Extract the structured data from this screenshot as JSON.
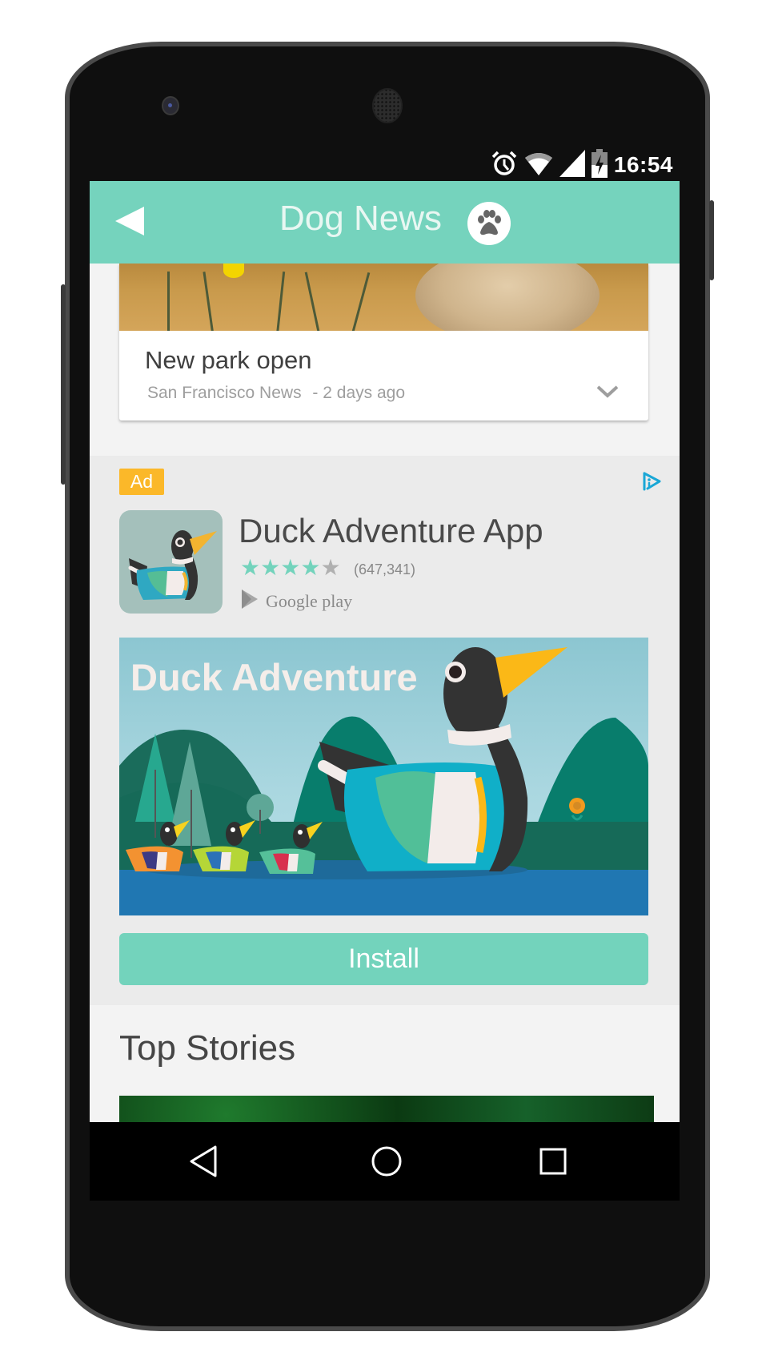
{
  "status_bar": {
    "time": "16:54",
    "icons": [
      "alarm-icon",
      "wifi-icon",
      "cellular-signal-icon",
      "battery-charging-icon"
    ]
  },
  "app_bar": {
    "back_icon": "back-arrow-icon",
    "title": "Dog News",
    "logo_icon": "paw-icon",
    "accent_color": "#75d3bd"
  },
  "news_card": {
    "title": "New park open",
    "source": "San Francisco News",
    "time_ago": "- 2 days ago",
    "expand_icon": "chevron-down-icon"
  },
  "ad": {
    "badge": "Ad",
    "adchoices_icon": "adchoices-icon",
    "app_name": "Duck Adventure App",
    "rating": 4.5,
    "rating_max": 5,
    "rating_count": "(647,341)",
    "store": "Google play",
    "banner_title": "Duck Adventure",
    "install_label": "Install",
    "badge_color": "#fbb829",
    "star_color": "#73d3bc"
  },
  "section": {
    "title": "Top Stories"
  },
  "nav_bar": {
    "back": "nav-back-icon",
    "home": "nav-home-icon",
    "recents": "nav-recents-icon"
  }
}
